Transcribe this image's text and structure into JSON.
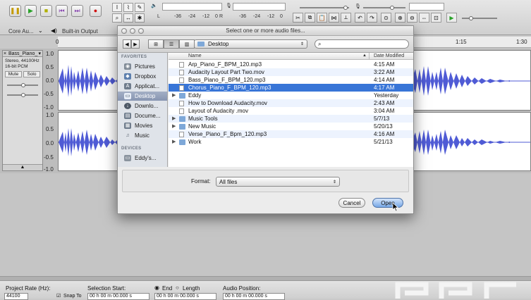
{
  "toolbar": {
    "meter_ticks_left": [
      "L",
      "-36",
      "-24",
      "-12",
      "0"
    ],
    "meter_ticks_right": [
      "R",
      "-36",
      "-24",
      "-12",
      "0"
    ],
    "meter_lr": [
      "L",
      "R"
    ]
  },
  "device_row": {
    "host": "Core Au...",
    "output": "Built-in Output"
  },
  "ruler": {
    "ticks": [
      "0",
      "1:15",
      "1:30"
    ]
  },
  "track": {
    "name": "Bass_Piano_",
    "format": "Stereo, 44100Hz",
    "bits": "16-bit PCM",
    "mute": "Mute",
    "solo": "Solo",
    "scale_top": [
      "1.0",
      "0.5",
      "0.0",
      "-0.5",
      "-1.0"
    ],
    "scale_bottom": [
      "1.0",
      "0.5",
      "0.0",
      "-0.5",
      "-1.0"
    ]
  },
  "dialog": {
    "title": "Select one or more audio files...",
    "location": "Desktop",
    "search_placeholder": "",
    "sidebar_favorites_heading": "FAVORITES",
    "sidebar_devices_heading": "DEVICES",
    "favorites": [
      {
        "label": "Pictures",
        "icon": "camera-icon",
        "selected": false
      },
      {
        "label": "Dropbox",
        "icon": "dropbox-icon",
        "selected": false
      },
      {
        "label": "Applicat...",
        "icon": "applications-icon",
        "selected": false
      },
      {
        "label": "Desktop",
        "icon": "desktop-icon",
        "selected": true
      },
      {
        "label": "Downlo...",
        "icon": "downloads-icon",
        "selected": false
      },
      {
        "label": "Docume...",
        "icon": "documents-icon",
        "selected": false
      },
      {
        "label": "Movies",
        "icon": "movies-icon",
        "selected": false
      },
      {
        "label": "Music",
        "icon": "music-icon",
        "selected": false
      }
    ],
    "devices": [
      {
        "label": "Eddy's...",
        "icon": "computer-icon"
      }
    ],
    "columns": {
      "name": "Name",
      "date": "Date Modified"
    },
    "files": [
      {
        "name": "Arp_Piano_F_BPM_120.mp3",
        "date": "4:15 AM",
        "kind": "file",
        "selected": false
      },
      {
        "name": "Audacity Layout Part Two.mov",
        "date": "3:22 AM",
        "kind": "file",
        "selected": false
      },
      {
        "name": "Bass_Piano_F_BPM_120.mp3",
        "date": "4:14 AM",
        "kind": "file",
        "selected": false
      },
      {
        "name": "Chorus_Piano_F_BPM_120.mp3",
        "date": "4:17 AM",
        "kind": "file",
        "selected": true
      },
      {
        "name": "Eddy",
        "date": "Yesterday",
        "kind": "folder",
        "selected": false
      },
      {
        "name": "How to Download Audacity.mov",
        "date": "2:43 AM",
        "kind": "file",
        "selected": false
      },
      {
        "name": "Layout of Audacity .mov",
        "date": "3:04 AM",
        "kind": "file",
        "selected": false
      },
      {
        "name": "Music Tools",
        "date": "5/7/13",
        "kind": "folder",
        "selected": false
      },
      {
        "name": "New Music",
        "date": "5/20/13",
        "kind": "folder",
        "selected": false
      },
      {
        "name": "Verse_Piano_F_Bpm_120.mp3",
        "date": "4:16 AM",
        "kind": "file",
        "selected": false
      },
      {
        "name": "Work",
        "date": "5/21/13",
        "kind": "folder",
        "selected": false
      }
    ],
    "format_label": "Format:",
    "format_value": "All files",
    "cancel": "Cancel",
    "open": "Open"
  },
  "selection_bar": {
    "project_rate_label": "Project Rate (Hz):",
    "project_rate_value": "44100",
    "snap_label": "Snap To",
    "selection_start_label": "Selection Start:",
    "end_label": "End",
    "length_label": "Length",
    "audio_position_label": "Audio Position:",
    "time_value": "00 h 00 m 00.000 s"
  }
}
